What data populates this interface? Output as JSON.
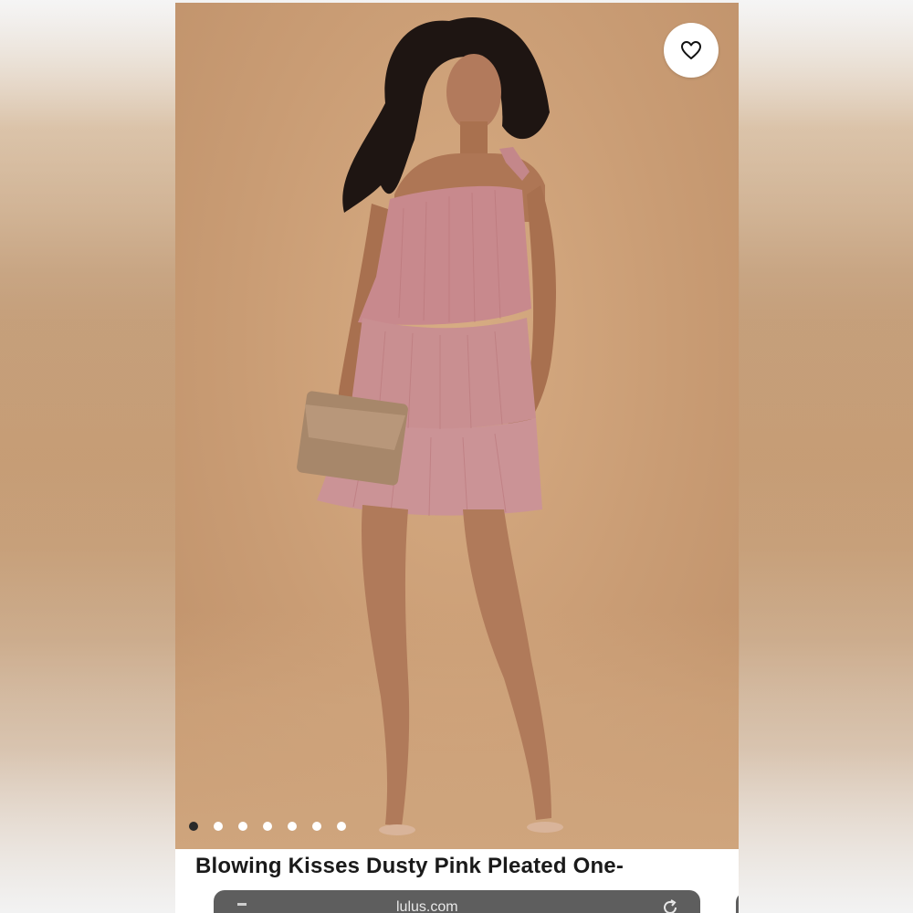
{
  "product": {
    "title": "Blowing Kisses Dusty Pink Pleated One-"
  },
  "carousel": {
    "total_images": 7,
    "active_index": 0
  },
  "browser": {
    "url_text": "lulus.com"
  },
  "icons": {
    "favorite": "heart-icon",
    "reload": "reload-icon"
  },
  "colors": {
    "backdrop": "#c99c74",
    "dress": "#c98c8f",
    "url_bar": "#5e5e5e"
  }
}
